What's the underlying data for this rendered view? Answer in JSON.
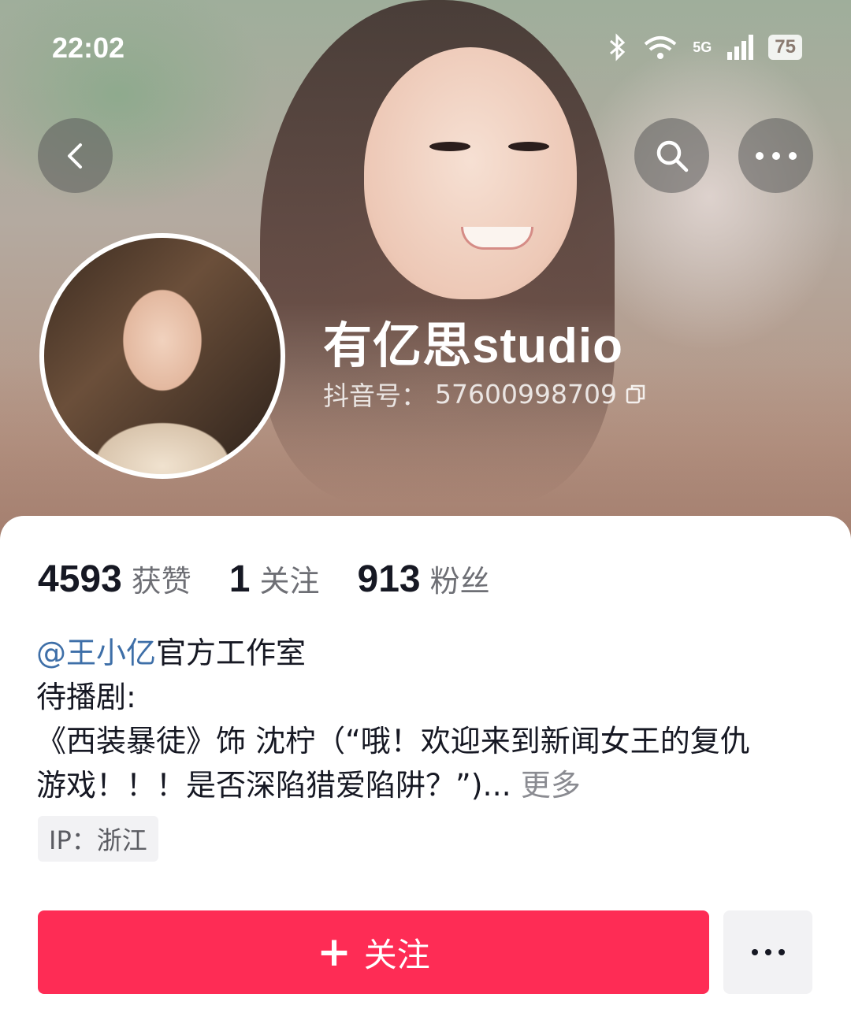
{
  "status_bar": {
    "time": "22:02",
    "network": "5G",
    "battery": "75"
  },
  "profile": {
    "name": "有亿思studio",
    "douyin_id_label": "抖音号：",
    "douyin_id": "57600998709"
  },
  "stats": [
    {
      "value": "4593",
      "label": "获赞"
    },
    {
      "value": "1",
      "label": "关注"
    },
    {
      "value": "913",
      "label": "粉丝"
    }
  ],
  "bio": {
    "mention": "@王小亿",
    "line1_rest": "官方工作室",
    "line2": "待播剧:",
    "line3": "《西装暴徒》饰 沈柠（“哦！欢迎来到新闻女王的复仇",
    "line4": "游戏！！！是否深陷猎爱陷阱？”)...",
    "more": "更多"
  },
  "ip": {
    "text": "IP：浙江"
  },
  "actions": {
    "follow_label": "关注",
    "follow_color": "#fe2c55"
  },
  "icons": [
    "back-icon",
    "search-icon",
    "more-icon",
    "bluetooth-icon",
    "wifi-icon",
    "signal-icon",
    "copy-icon",
    "plus-icon"
  ]
}
